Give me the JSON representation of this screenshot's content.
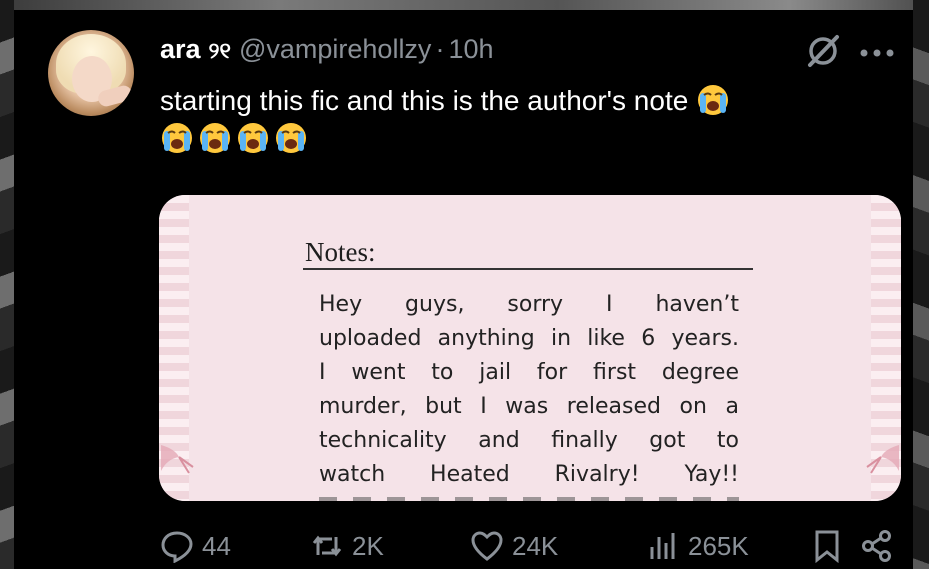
{
  "tweet": {
    "display_name": "ara",
    "name_glyph": "୨୧",
    "handle": "@vampirehollzy",
    "separator": "·",
    "time": "10h",
    "text": "starting this fic and this is the author's note",
    "emoji_name": "loudly-crying-face",
    "emoji_count": 5
  },
  "media": {
    "heading": "Notes:",
    "lines": [
      "Hey guys, sorry I haven’t",
      "uploaded anything in like 6 years.",
      "I went to jail for first degree",
      "murder, but I was released on a",
      "technicality and finally got to",
      "watch Heated Rivalry! Yay!!"
    ]
  },
  "actions": {
    "replies": "44",
    "reposts": "2K",
    "likes": "24K",
    "views": "265K"
  },
  "icons": {
    "grok": "grok-icon",
    "more": "more-icon",
    "reply": "reply-icon",
    "repost": "repost-icon",
    "like": "like-icon",
    "views": "views-icon",
    "bookmark": "bookmark-icon",
    "share": "share-icon"
  },
  "colors": {
    "background": "#000000",
    "text": "#ffffff",
    "muted": "#8b9198",
    "note_card": "#f5e3e8"
  }
}
